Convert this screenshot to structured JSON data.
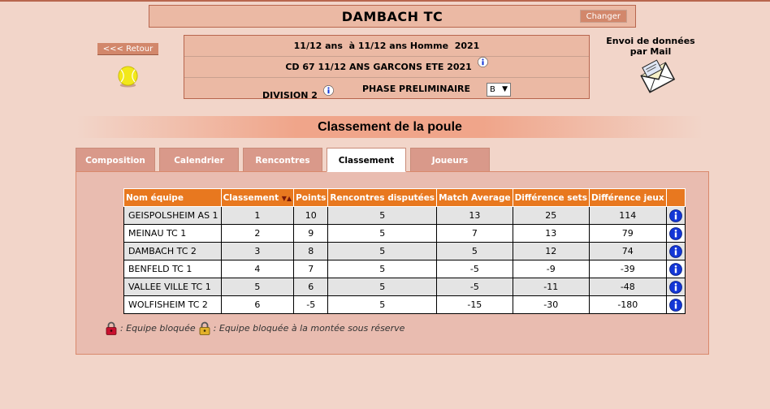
{
  "club": {
    "name": "DAMBACH TC",
    "change_label": "Changer"
  },
  "nav": {
    "back_label": "<<< Retour"
  },
  "info": {
    "line1": "11/12 ans  à 11/12 ans Homme  2021",
    "line2": "CD 67 11/12 ANS GARCONS ETE 2021",
    "division": "DIVISION 2",
    "phase": "PHASE PRELIMINAIRE",
    "group_selected": "B"
  },
  "mail": {
    "label": "Envoi de données par Mail"
  },
  "section": {
    "title": "Classement de la poule"
  },
  "tabs": [
    {
      "label": "Composition",
      "active": false
    },
    {
      "label": "Calendrier",
      "active": false
    },
    {
      "label": "Rencontres",
      "active": false
    },
    {
      "label": "Classement",
      "active": true
    },
    {
      "label": "Joueurs",
      "active": false
    }
  ],
  "table": {
    "headers": [
      "Nom équipe",
      "Classement",
      "Points",
      "Rencontres disputées",
      "Match Average",
      "Différence sets",
      "Différence jeux",
      ""
    ],
    "rows": [
      {
        "team": "GEISPOLSHEIM AS 1",
        "rank": "1",
        "points": "10",
        "played": "5",
        "match_avg": "13",
        "diff_sets": "25",
        "diff_games": "114"
      },
      {
        "team": "MEINAU TC 1",
        "rank": "2",
        "points": "9",
        "played": "5",
        "match_avg": "7",
        "diff_sets": "13",
        "diff_games": "79"
      },
      {
        "team": "DAMBACH TC 2",
        "rank": "3",
        "points": "8",
        "played": "5",
        "match_avg": "5",
        "diff_sets": "12",
        "diff_games": "74"
      },
      {
        "team": "BENFELD TC 1",
        "rank": "4",
        "points": "7",
        "played": "5",
        "match_avg": "-5",
        "diff_sets": "-9",
        "diff_games": "-39"
      },
      {
        "team": "VALLEE VILLE TC 1",
        "rank": "5",
        "points": "6",
        "played": "5",
        "match_avg": "-5",
        "diff_sets": "-11",
        "diff_games": "-48"
      },
      {
        "team": "WOLFISHEIM TC 2",
        "rank": "6",
        "points": "-5",
        "played": "5",
        "match_avg": "-15",
        "diff_sets": "-30",
        "diff_games": "-180"
      }
    ]
  },
  "legend": {
    "blocked": ": Equipe bloquée",
    "blocked_promotion": ": Equipe bloquée à la montée sous réserve"
  },
  "colors": {
    "header_orange": "#e8781f",
    "accent": "#d2876b",
    "background": "#f2d5c9",
    "info_blue": "#1336d6"
  }
}
